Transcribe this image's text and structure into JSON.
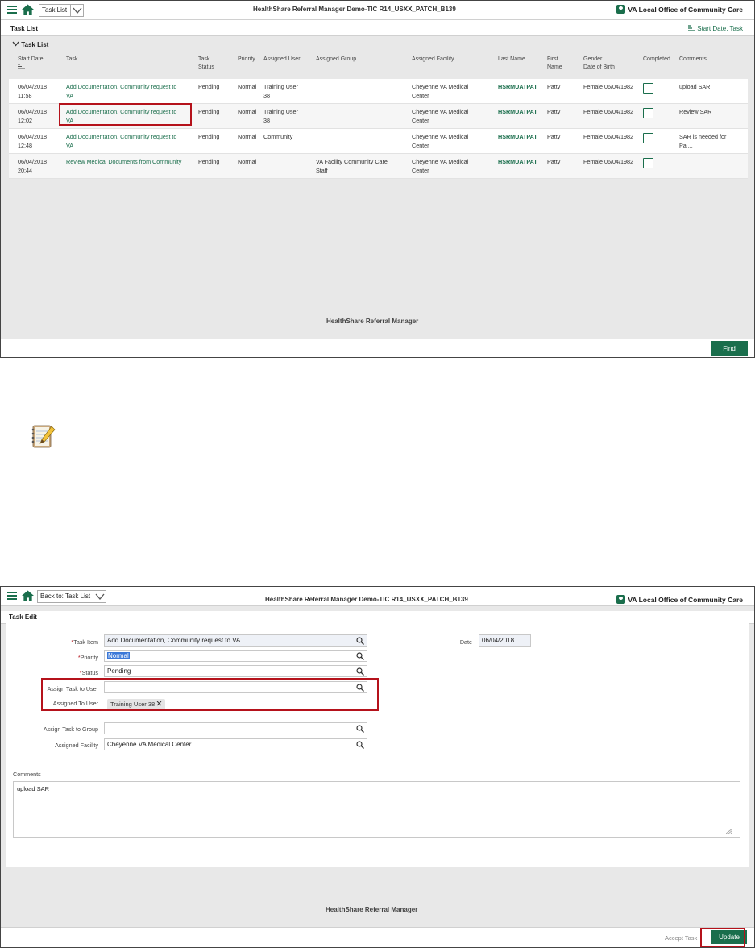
{
  "colors": {
    "accent": "#1a6e4c",
    "highlight": "#b5121b",
    "selection": "#3b78d8"
  },
  "panel1": {
    "nav_select": "Task List",
    "app_title": "HealthShare Referral Manager Demo-TIC R14_USXX_PATCH_B139",
    "office": "VA Local Office of Community Care",
    "subbar_title": "Task List",
    "sort_label": "Start Date, Task",
    "section_title": "Task List",
    "columns": {
      "start_date": "Start Date",
      "task": "Task",
      "task_status_1": "Task",
      "task_status_2": "Status",
      "priority": "Priority",
      "assigned_user": "Assigned User",
      "assigned_group": "Assigned Group",
      "assigned_facility": "Assigned Facility",
      "last_name": "Last Name",
      "first_name_1": "First",
      "first_name_2": "Name",
      "gender_1": "Gender",
      "gender_2": "Date of Birth",
      "completed": "Completed",
      "comments": "Comments"
    },
    "rows": [
      {
        "date": "06/04/2018",
        "time": "11:58",
        "task_1": "Add Documentation, Community request to",
        "task_2": "VA",
        "status": "Pending",
        "priority": "Normal",
        "user_1": "Training User",
        "user_2": "38",
        "group_1": "",
        "group_2": "",
        "facility_1": "Cheyenne VA Medical",
        "facility_2": "Center",
        "last": "HSRMUATPAT",
        "first": "Patty",
        "gender_dob": "Female 06/04/1982",
        "comments_1": "upload SAR",
        "comments_2": ""
      },
      {
        "date": "06/04/2018",
        "time": "12:02",
        "task_1": "Add Documentation, Community request to",
        "task_2": "VA",
        "status": "Pending",
        "priority": "Normal",
        "user_1": "Training User",
        "user_2": "38",
        "group_1": "",
        "group_2": "",
        "facility_1": "Cheyenne VA Medical",
        "facility_2": "Center",
        "last": "HSRMUATPAT",
        "first": "Patty",
        "gender_dob": "Female 06/04/1982",
        "comments_1": "Review SAR",
        "comments_2": ""
      },
      {
        "date": "06/04/2018",
        "time": "12:48",
        "task_1": "Add Documentation, Community request to",
        "task_2": "VA",
        "status": "Pending",
        "priority": "Normal",
        "user_1": "Community",
        "user_2": "",
        "group_1": "",
        "group_2": "",
        "facility_1": "Cheyenne VA Medical",
        "facility_2": "Center",
        "last": "HSRMUATPAT",
        "first": "Patty",
        "gender_dob": "Female 06/04/1982",
        "comments_1": "SAR is needed for",
        "comments_2": "Pa ..."
      },
      {
        "date": "06/04/2018",
        "time": "20:44",
        "task_1": "Review Medical Documents from Community",
        "task_2": "",
        "status": "Pending",
        "priority": "Normal",
        "user_1": "",
        "user_2": "",
        "group_1": "VA Facility Community Care",
        "group_2": "Staff",
        "facility_1": "Cheyenne VA Medical",
        "facility_2": "Center",
        "last": "HSRMUATPAT",
        "first": "Patty",
        "gender_dob": "Female 06/04/1982",
        "comments_1": "",
        "comments_2": ""
      }
    ],
    "footer_title": "HealthShare Referral Manager",
    "find_button": "Find"
  },
  "panel2": {
    "nav_select": "Back to: Task List",
    "app_title": "HealthShare Referral Manager Demo-TIC R14_USXX_PATCH_B139",
    "office": "VA Local Office of Community Care",
    "subbar_title": "Task Edit",
    "form": {
      "task_item_label": "Task Item",
      "task_item_value": "Add Documentation, Community request to VA",
      "priority_label": "Priority",
      "priority_value": "Normal",
      "status_label": "Status",
      "status_value": "Pending",
      "assign_user_label": "Assign Task to User",
      "assign_user_value": "",
      "assigned_to_label": "Assigned To User",
      "assigned_to_chip": "Training User 38",
      "assign_group_label": "Assign Task to Group",
      "assign_group_value": "",
      "facility_label": "Assigned Facility",
      "facility_value": "Cheyenne VA Medical Center",
      "date_label": "Date",
      "date_value": "06/04/2018",
      "required_mark": "*"
    },
    "comments_label": "Comments",
    "comments_value": "upload SAR",
    "footer_title": "HealthShare Referral Manager",
    "accept_label": "Accept Task",
    "update_button": "Update"
  }
}
